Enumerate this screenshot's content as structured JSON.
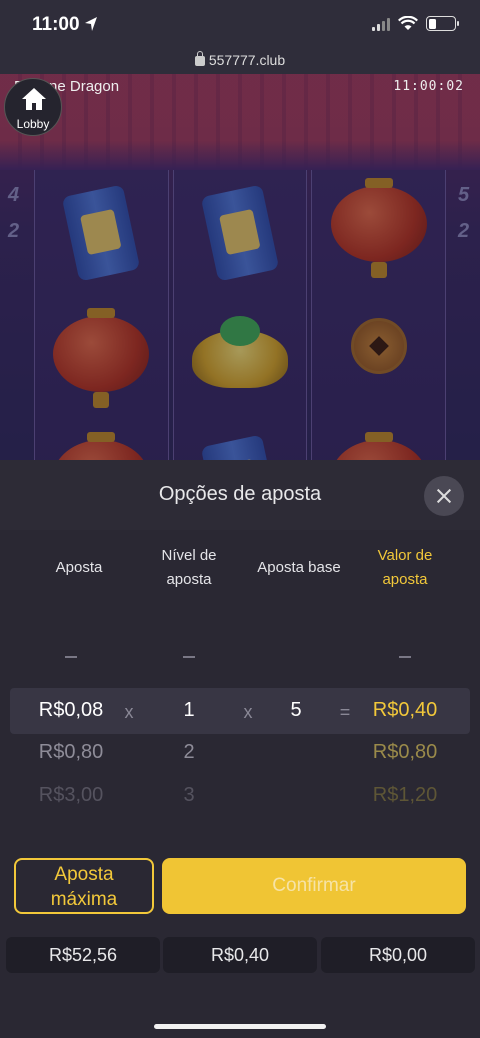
{
  "status_bar": {
    "time": "11:00"
  },
  "browser": {
    "url": "557777.club"
  },
  "game": {
    "title": "Fortune Dragon",
    "clock": "11:00:02",
    "lobby_label": "Lobby",
    "side_numbers_left": [
      "4",
      "2"
    ],
    "side_numbers_right": [
      "5",
      "2"
    ],
    "reels": [
      [
        "firecracker-can",
        "red-lantern",
        "red-lantern"
      ],
      [
        "firecracker-can",
        "gold-ingot",
        "firecracker-can"
      ],
      [
        "red-lantern",
        "bronze-coin",
        "red-lantern"
      ]
    ]
  },
  "bet_panel": {
    "title": "Opções de aposta",
    "columns": {
      "bet": "Aposta",
      "bet_level_line1": "Nível de",
      "bet_level_line2": "aposta",
      "base_bet": "Aposta base",
      "bet_value_line1": "Valor de",
      "bet_value_line2": "aposta"
    },
    "operators": {
      "times": "x",
      "equals": "="
    },
    "selected_row": {
      "bet": "R$0,08",
      "level": "1",
      "base": "5",
      "value": "R$0,40"
    },
    "other_rows": [
      {
        "bet": "R$0,80",
        "level": "2",
        "value": "R$0,80"
      },
      {
        "bet": "R$3,00",
        "level": "3",
        "value": "R$1,20"
      }
    ],
    "max_bet_line1": "Aposta",
    "max_bet_line2": "máxima",
    "confirm_label": "Confirmar"
  },
  "footer_stats": {
    "balance": "R$52,56",
    "bet": "R$0,40",
    "win": "R$0,00"
  },
  "colors": {
    "accent_gold": "#f2c83a",
    "panel_bg": "#2a2833"
  }
}
